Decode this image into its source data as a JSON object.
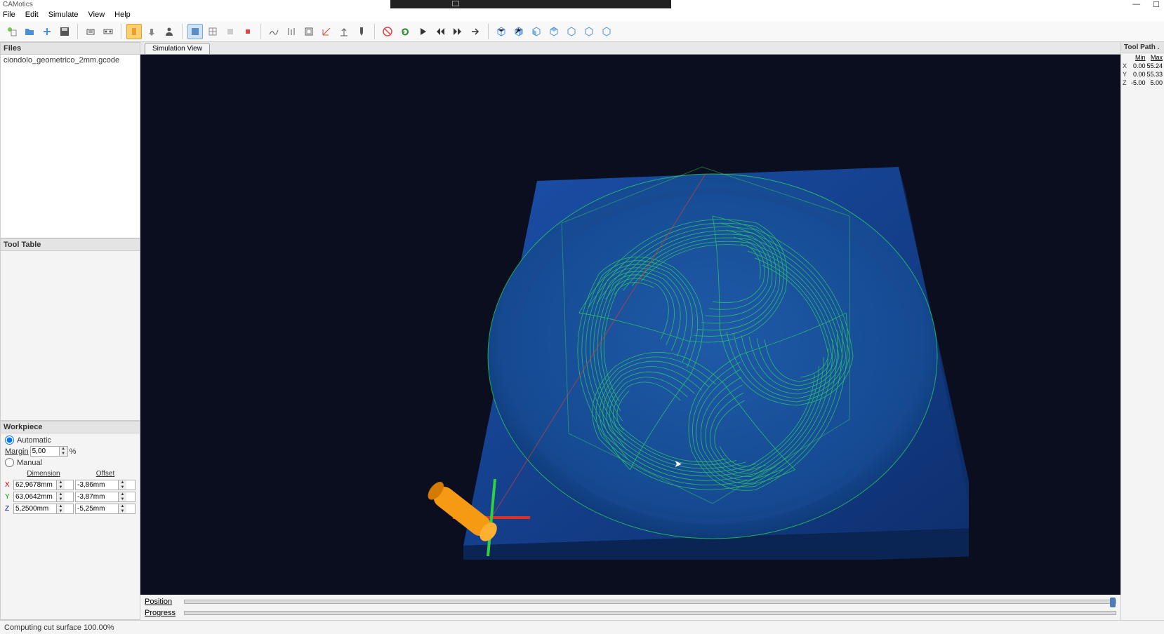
{
  "app": {
    "title": "CAMotics"
  },
  "menu": {
    "file": "File",
    "edit": "Edit",
    "simulate": "Simulate",
    "view": "View",
    "help": "Help"
  },
  "panels": {
    "files": {
      "title": "Files",
      "item": "ciondolo_geometrico_2mm.gcode"
    },
    "tooltable": {
      "title": "Tool Table"
    },
    "workpiece": {
      "title": "Workpiece",
      "automatic": "Automatic",
      "margin_label": "Margin",
      "margin_value": "5,00",
      "margin_unit": "%",
      "manual": "Manual",
      "dim_hdr": "Dimension",
      "off_hdr": "Offset",
      "rows": [
        {
          "axis": "X",
          "dim": "62,9678mm",
          "off": "-3,86mm"
        },
        {
          "axis": "Y",
          "dim": "63,0642mm",
          "off": "-3,87mm"
        },
        {
          "axis": "Z",
          "dim": "5,2500mm",
          "off": "-5,25mm"
        }
      ]
    },
    "toolpath": {
      "title": "Tool Path .",
      "min": "Min",
      "max": "Max",
      "rows": [
        {
          "axis": "X",
          "min": "0.00",
          "max": "55.24"
        },
        {
          "axis": "Y",
          "min": "0.00",
          "max": "55.33"
        },
        {
          "axis": "Z",
          "min": "-5.00",
          "max": "5.00"
        }
      ]
    }
  },
  "tab": {
    "sim": "Simulation View"
  },
  "sliders": {
    "position": "Position",
    "progress": "Progress"
  },
  "status": {
    "text": "Computing cut surface 100.00%"
  },
  "icons": {
    "new": "new",
    "open": "open",
    "add": "add",
    "save": "save",
    "export1": "export",
    "export2": "export2",
    "tool1": "tool",
    "tool2": "tool2",
    "person": "person",
    "v1": "view1",
    "v2": "view2",
    "v3": "view3",
    "v4": "view4",
    "v5": "view5",
    "g1": "graph1",
    "g2": "graph2",
    "g3": "graph3",
    "g4": "graph4",
    "axis": "axis",
    "toolbit": "toolbit",
    "stop": "stop",
    "reload": "reload",
    "play": "play",
    "rew": "rewind",
    "fwd": "forward",
    "end": "end",
    "c1": "cube1",
    "c2": "cube2",
    "c3": "cube3",
    "c4": "cube4",
    "c5": "cube5",
    "c6": "cube6",
    "c7": "cube7"
  }
}
